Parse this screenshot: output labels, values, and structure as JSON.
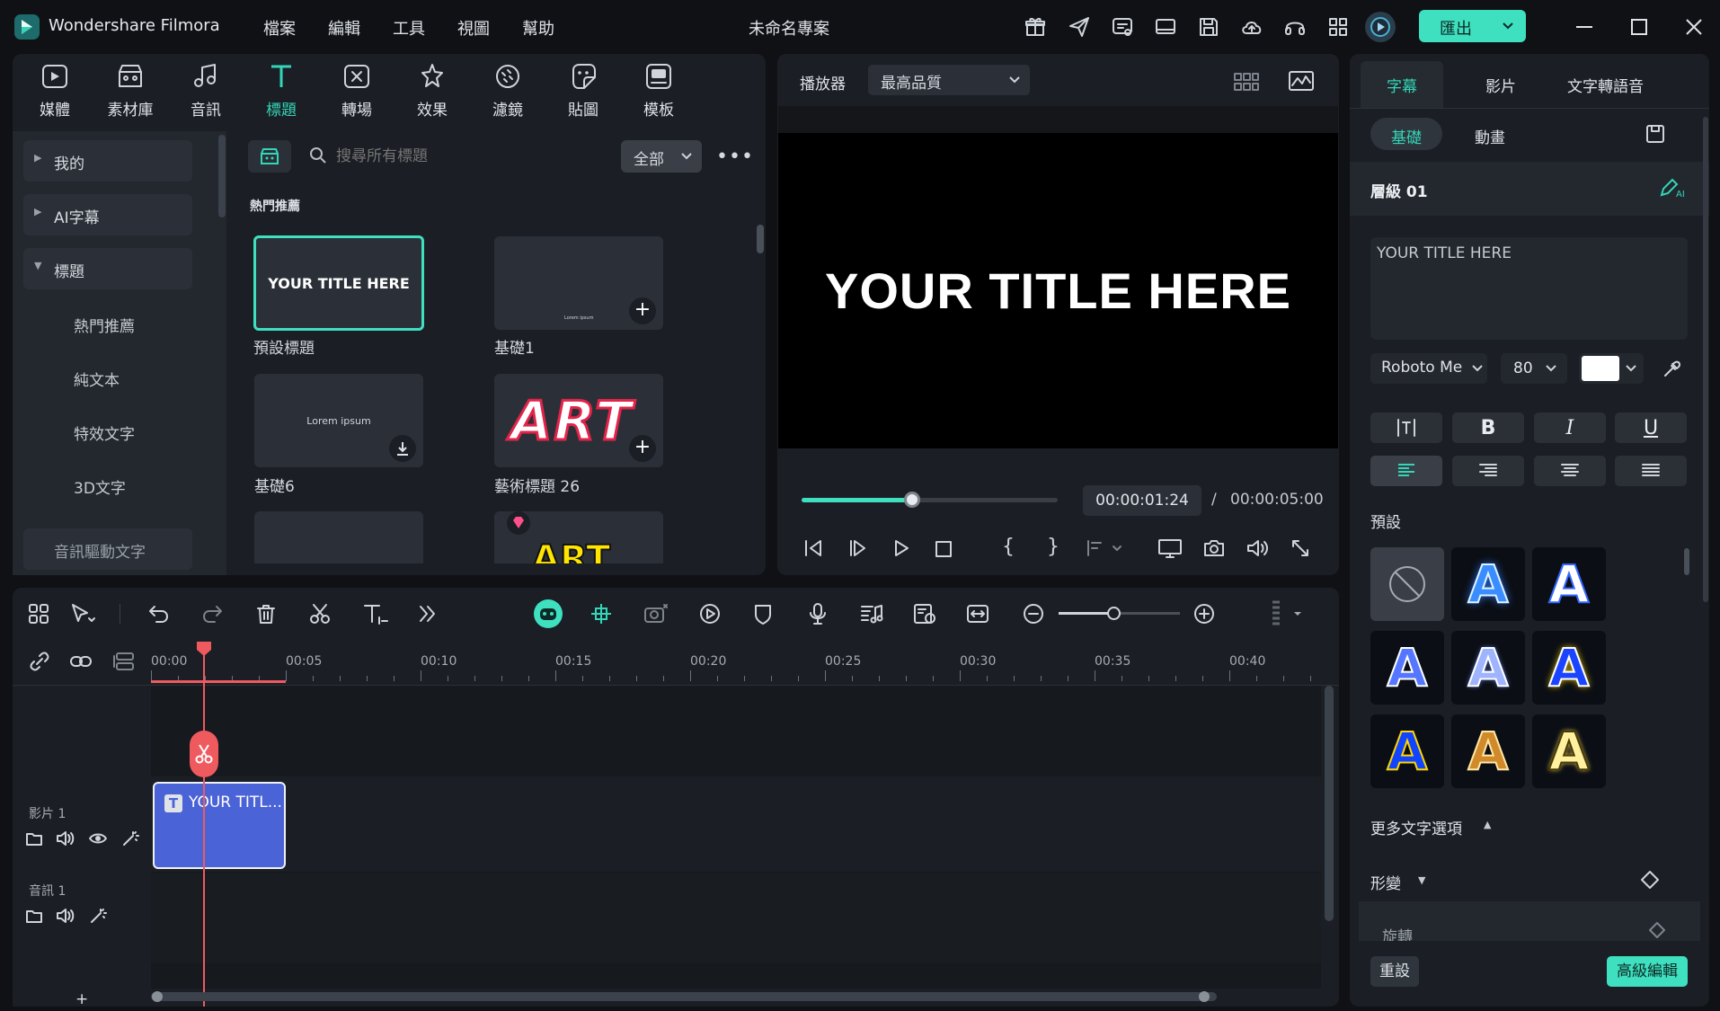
{
  "app": {
    "name": "Wondershare Filmora",
    "project_title": "未命名專案",
    "export_label": "匯出"
  },
  "menu": [
    "檔案",
    "編輯",
    "工具",
    "視圖",
    "幫助"
  ],
  "toolbar": [
    {
      "label": "媒體",
      "icon": "media-icon"
    },
    {
      "label": "素材庫",
      "icon": "stock-icon"
    },
    {
      "label": "音訊",
      "icon": "music-icon"
    },
    {
      "label": "標題",
      "icon": "title-icon"
    },
    {
      "label": "轉場",
      "icon": "transition-icon"
    },
    {
      "label": "效果",
      "icon": "effects-icon"
    },
    {
      "label": "濾鏡",
      "icon": "filter-icon"
    },
    {
      "label": "貼圖",
      "icon": "sticker-icon"
    },
    {
      "label": "模板",
      "icon": "template-icon"
    }
  ],
  "sidebar": {
    "items": [
      "我的",
      "AI字幕",
      "標題"
    ],
    "subitems": [
      "熱門推薦",
      "純文本",
      "特效文字",
      "3D文字"
    ],
    "audio_text": "音訊驅動文字"
  },
  "browser": {
    "search_placeholder": "搜尋所有標題",
    "filter": "全部",
    "section": "熱門推薦",
    "items": [
      {
        "label": "預設標題",
        "thumb_text": "YOUR TITLE HERE"
      },
      {
        "label": "基礎1",
        "thumb_text": "Lorem ipsum"
      },
      {
        "label": "基礎6",
        "thumb_text": "Lorem ipsum"
      },
      {
        "label": "藝術標題 26",
        "thumb_text": "ART"
      }
    ],
    "partial_thumb_text": "ART"
  },
  "player": {
    "label": "播放器",
    "quality": "最高品質",
    "preview_text": "YOUR TITLE HERE",
    "current_time": "00:00:01:24",
    "separator": "/",
    "total_time": "00:00:05:00",
    "progress": 0.43
  },
  "timeline": {
    "ticks": [
      "00:00",
      "00:05",
      "00:10",
      "00:15",
      "00:20",
      "00:25",
      "00:30",
      "00:35",
      "00:40"
    ],
    "tracks": [
      "影片 1",
      "音訊 1"
    ],
    "clip_label": "YOUR TITL...",
    "zoom": 0.45,
    "add_track": "+"
  },
  "inspector": {
    "tabs": [
      "字幕",
      "影片",
      "文字轉語音"
    ],
    "subtabs": [
      "基礎",
      "動畫"
    ],
    "layer": "層級 01",
    "text_value": "YOUR TITLE HERE",
    "font": "Roboto Me",
    "size": "80",
    "text_color": "#ffffff",
    "format_buttons": [
      "B",
      "I",
      "U"
    ],
    "presets_label": "預設",
    "more_options": "更多文字選項",
    "transform": "形變",
    "rotate_partial": "旋轉",
    "reset": "重設",
    "advanced": "高級編輯",
    "preset_letter": "A"
  },
  "colors": {
    "accent": "#33d6b8",
    "playhead": "#ef5a5f",
    "clip": "#4a63d6",
    "panel": "#1b1e24"
  }
}
